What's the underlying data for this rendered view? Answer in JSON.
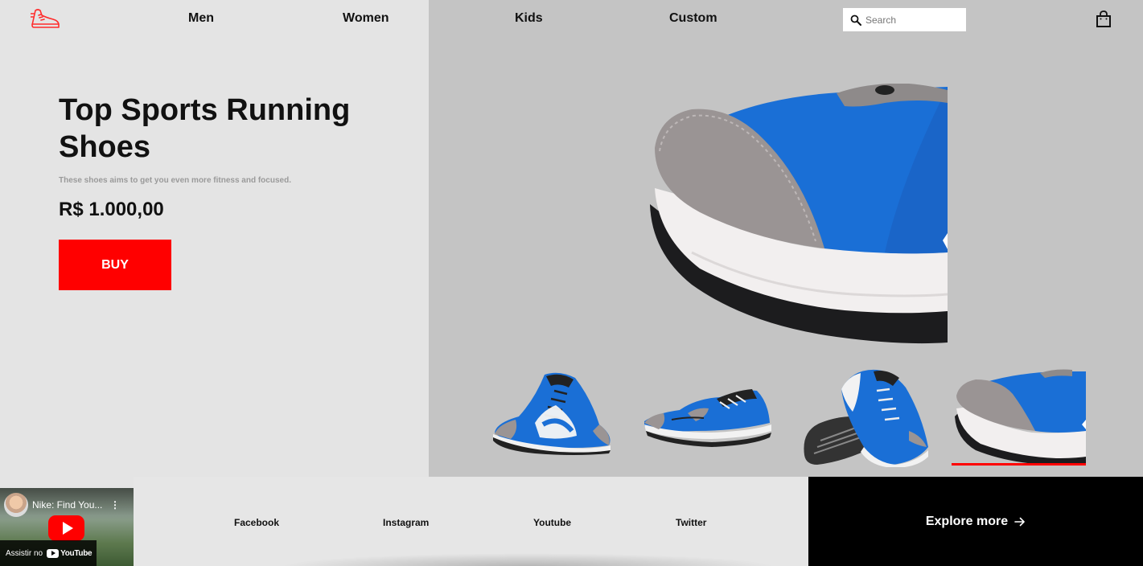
{
  "header": {
    "logo_icon": "running-shoe-logo-icon",
    "nav": [
      {
        "label": "Men"
      },
      {
        "label": "Women"
      },
      {
        "label": "Kids"
      },
      {
        "label": "Custom"
      }
    ],
    "search": {
      "placeholder": "Search",
      "icon": "search-icon"
    },
    "bag_icon": "shopping-bag-icon"
  },
  "hero": {
    "title": "Top Sports Running Shoes",
    "subtitle": "These shoes aims to get you even more fitness and focused.",
    "price": "R$ 1.000,00",
    "buy_label": "BUY"
  },
  "gallery": {
    "selected_index": 3,
    "thumbnails": [
      "shoe-pair-side",
      "shoe-pair-front",
      "shoe-pair-sole",
      "shoe-toe-closeup"
    ]
  },
  "video": {
    "title": "Nike: Find You...",
    "watch_label": "Assistir no",
    "platform": "YouTube"
  },
  "footer": {
    "social": [
      {
        "label": "Facebook"
      },
      {
        "label": "Instagram"
      },
      {
        "label": "Youtube"
      },
      {
        "label": "Twitter"
      }
    ],
    "explore_label": "Explore more"
  },
  "colors": {
    "accent": "#ff0000",
    "left_bg": "#e4e4e4",
    "right_bg": "#c4c4c4",
    "shoe_blue": "#1a6fd6",
    "dark": "#000000"
  }
}
